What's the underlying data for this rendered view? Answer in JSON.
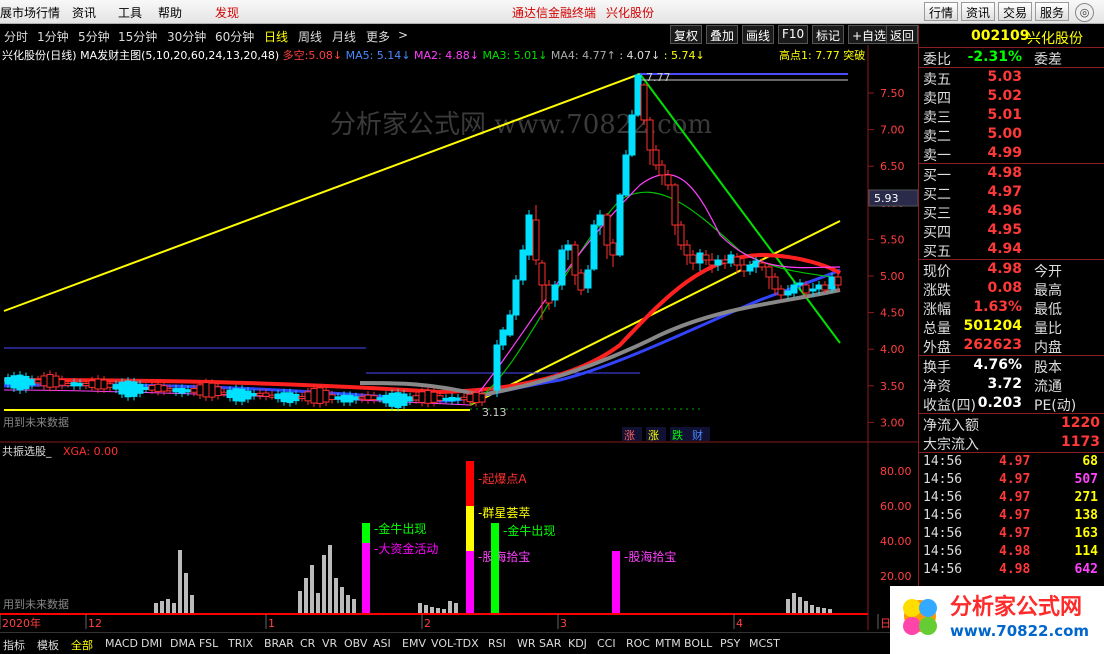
{
  "menu": {
    "items": [
      "展市场行情",
      "资讯",
      "工具",
      "帮助",
      "发现"
    ],
    "center_links": [
      "通达信金融终端",
      "兴化股份"
    ],
    "right_buttons": [
      "行情",
      "资讯",
      "交易",
      "服务"
    ],
    "circle": "◎"
  },
  "periods": [
    "分时",
    "1分钟",
    "5分钟",
    "15分钟",
    "30分钟",
    "60分钟",
    "日线",
    "周线",
    "月线",
    "更多",
    ">"
  ],
  "chart_buttons": [
    "复权",
    "叠加",
    "画线",
    "F10",
    "标记",
    "+自选",
    "返回"
  ],
  "chart": {
    "title": "兴化股份(日线)",
    "indicator": "MA发财主图(5,10,20,60,24,13,20,48)",
    "duokong_label": "多空:",
    "duokong_val": "5.08",
    "ma5": "MA5: 5.14",
    "ma2": "MA2: 4.88",
    "ma3": "MA3: 5.01",
    "ma4": "MA4: 4.77",
    "extra1": ": 4.07",
    "extra2": ": 5.74",
    "high_label": "高点1: 7.77",
    "breakout": "突破",
    "price_ticks": [
      "7.50",
      "7.00",
      "6.50",
      "6.00",
      "5.50",
      "5.00",
      "4.50",
      "4.00",
      "3.50",
      "3.00"
    ],
    "current_box": "5.93",
    "high_mark": "7.77",
    "low_mark": "3.13",
    "watermark": "分析家公式网 www.70822.com",
    "future_note": "用到未来数据",
    "small_labels": [
      "涨",
      "涨",
      "跌",
      "财"
    ]
  },
  "sub": {
    "title": "共振选股_",
    "xga": "XGA: 0.00",
    "ticks": [
      "80.00",
      "60.00",
      "40.00",
      "20.00"
    ],
    "future_note": "用到未来数据",
    "signals": [
      "金牛出现",
      "大资金活动",
      "起爆点A",
      "群星荟萃",
      "股海拾宝",
      "金牛出现",
      "股海拾宝"
    ],
    "dates": [
      "2020年",
      "12",
      "1",
      "2",
      "3",
      "4",
      "日"
    ]
  },
  "stock": {
    "code": "002109",
    "name": "兴化股份",
    "weibi_label": "委比",
    "weibi": "-2.31%",
    "weicha_label": "委差",
    "asks": [
      {
        "label": "卖五",
        "price": "5.03"
      },
      {
        "label": "卖四",
        "price": "5.02"
      },
      {
        "label": "卖三",
        "price": "5.01"
      },
      {
        "label": "卖二",
        "price": "5.00"
      },
      {
        "label": "卖一",
        "price": "4.99"
      }
    ],
    "bids": [
      {
        "label": "买一",
        "price": "4.98"
      },
      {
        "label": "买二",
        "price": "4.97"
      },
      {
        "label": "买三",
        "price": "4.96"
      },
      {
        "label": "买四",
        "price": "4.95"
      },
      {
        "label": "买五",
        "price": "4.94"
      }
    ],
    "stats": [
      {
        "l": "现价",
        "v": "4.98",
        "l2": "今开",
        "color": "#ff3838"
      },
      {
        "l": "涨跌",
        "v": "0.08",
        "l2": "最高",
        "color": "#ff3838"
      },
      {
        "l": "涨幅",
        "v": "1.63%",
        "l2": "最低",
        "color": "#ff3838"
      },
      {
        "l": "总量",
        "v": "501204",
        "l2": "量比",
        "color": "#ffff00"
      },
      {
        "l": "外盘",
        "v": "262623",
        "l2": "内盘",
        "color": "#ff3838"
      }
    ],
    "stats2": [
      {
        "l": "换手",
        "v": "4.76%",
        "l2": "股本"
      },
      {
        "l": "净资",
        "v": "3.72",
        "l2": "流通"
      },
      {
        "l": "收益(四)",
        "v": "0.203",
        "l2": "PE(动)"
      }
    ],
    "flows": [
      {
        "l": "净流入额",
        "v": "1220"
      },
      {
        "l": "大宗流入",
        "v": "1173"
      }
    ],
    "ticks": [
      {
        "t": "14:56",
        "p": "4.97",
        "q": "68",
        "c": "#ffff00"
      },
      {
        "t": "14:56",
        "p": "4.97",
        "q": "507",
        "c": "#ff44ff"
      },
      {
        "t": "14:56",
        "p": "4.97",
        "q": "271",
        "c": "#ffff00"
      },
      {
        "t": "14:56",
        "p": "4.97",
        "q": "138",
        "c": "#ffff00"
      },
      {
        "t": "14:56",
        "p": "4.97",
        "q": "163",
        "c": "#ffff00"
      },
      {
        "t": "14:56",
        "p": "4.98",
        "q": "114",
        "c": "#ffff00"
      },
      {
        "t": "14:56",
        "p": "4.98",
        "q": "642",
        "c": "#ff44ff"
      }
    ]
  },
  "bottom_tabs": [
    "指标",
    "模板",
    "全部",
    "MACD",
    "DMI",
    "DMA",
    "FSL",
    "TRIX",
    "BRAR",
    "CR",
    "VR",
    "OBV",
    "ASI",
    "EMV",
    "VOL-TDX",
    "RSI",
    "WR",
    "SAR",
    "KDJ",
    "CCI",
    "ROC",
    "MTM",
    "BOLL",
    "PSY",
    "MCST"
  ],
  "logo": {
    "cn": "分析家公式网",
    "url": "www.70822.com"
  },
  "colors": {
    "up": "#ff3838",
    "down": "#00e5ff",
    "ma_yellow": "#ffff00",
    "accent_red": "#ff0000"
  }
}
